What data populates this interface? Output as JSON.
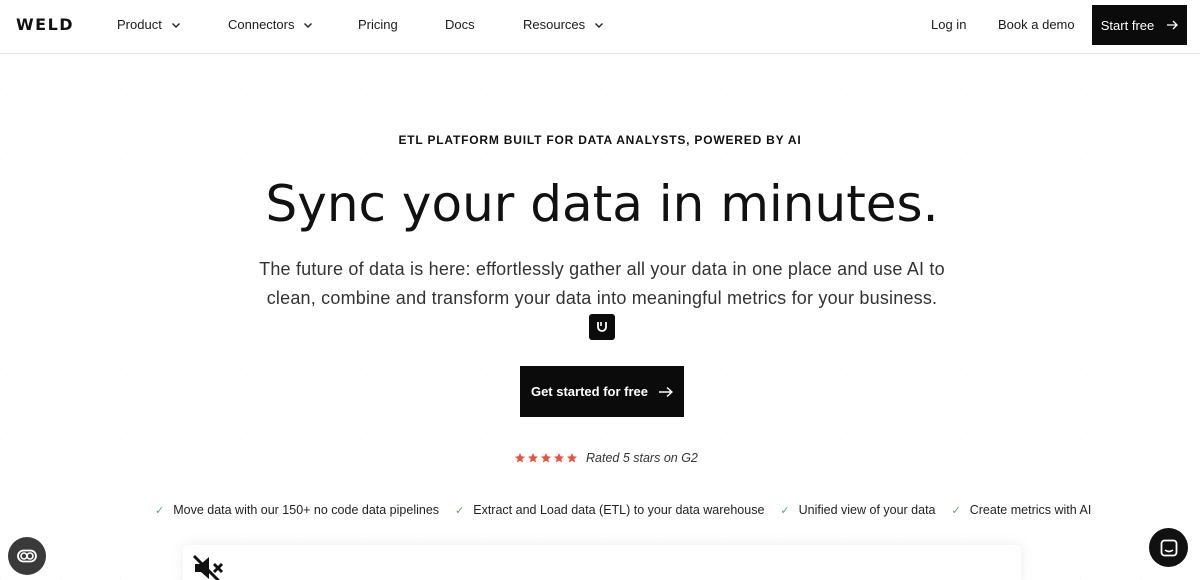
{
  "nav": {
    "logo": "WELD",
    "items": [
      {
        "label": "Product",
        "has_dropdown": true
      },
      {
        "label": "Connectors",
        "has_dropdown": true
      },
      {
        "label": "Pricing",
        "has_dropdown": false
      },
      {
        "label": "Docs",
        "has_dropdown": false
      },
      {
        "label": "Resources",
        "has_dropdown": true
      }
    ],
    "login": "Log in",
    "demo": "Book a demo",
    "start": "Start free"
  },
  "hero": {
    "eyebrow": "ETL PLATFORM BUILT FOR DATA ANALYSTS, POWERED BY AI",
    "headline": "Sync your data in minutes.",
    "subtext": "The future of data is here: effortlessly gather all your data in one place and use AI to clean, combine and transform your data into meaningful metrics for your business.",
    "cta": "Get started for free",
    "rating_stars": 5,
    "rating_text": "Rated 5 stars on G2",
    "star_color": "#e8533f",
    "features": [
      "Move data with our 150+ no code data pipelines",
      "Extract and Load data (ETL) to your data warehouse",
      "Unified view of your data",
      "Create metrics with AI"
    ]
  },
  "icons": {
    "badge": "smile-icon",
    "cta_arrow": "arrow-right-icon",
    "video": "mute-icon",
    "widget_left": "eye-toggle-icon",
    "widget_right": "chat-icon"
  }
}
